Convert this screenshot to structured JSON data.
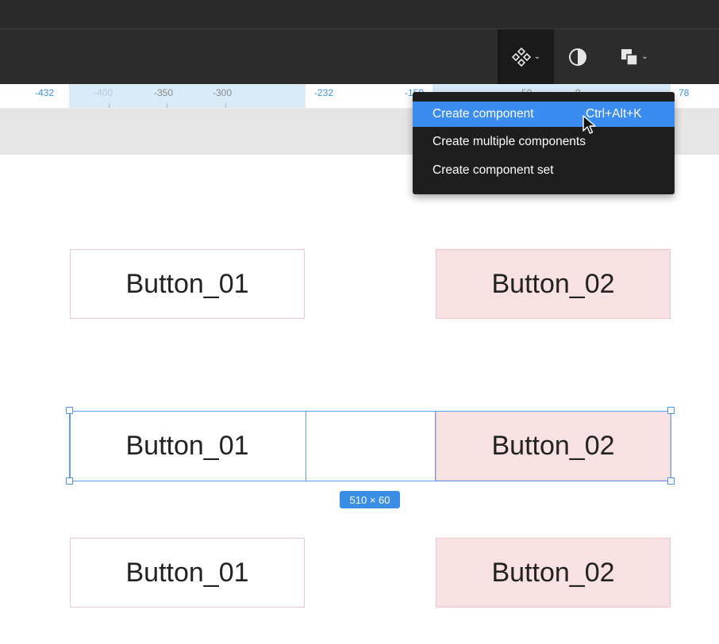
{
  "toolbar": {
    "component_icon": "component-icon",
    "contrast_icon": "contrast-icon",
    "boolean_icon": "boolean-groups-icon"
  },
  "ruler": {
    "labels": [
      "-432",
      "-400",
      "-350",
      "-300",
      "-232",
      "-150",
      "-50",
      "0",
      "78"
    ]
  },
  "menu": {
    "items": [
      {
        "label": "Create component",
        "shortcut": "Ctrl+Alt+K"
      },
      {
        "label": "Create multiple components"
      },
      {
        "label": "Create component set"
      }
    ]
  },
  "buttons": {
    "row1": [
      "Button_01",
      "Button_02"
    ],
    "row2": [
      "Button_01",
      "Button_02"
    ],
    "row3": [
      "Button_01",
      "Button_02"
    ]
  },
  "selection": {
    "size_label": "510 × 60"
  },
  "colors": {
    "accent": "#3b8ee6",
    "menu_bg": "#1e1e1e",
    "menu_highlight": "#3b8cf0",
    "button_pink": "#f8e1e2"
  }
}
